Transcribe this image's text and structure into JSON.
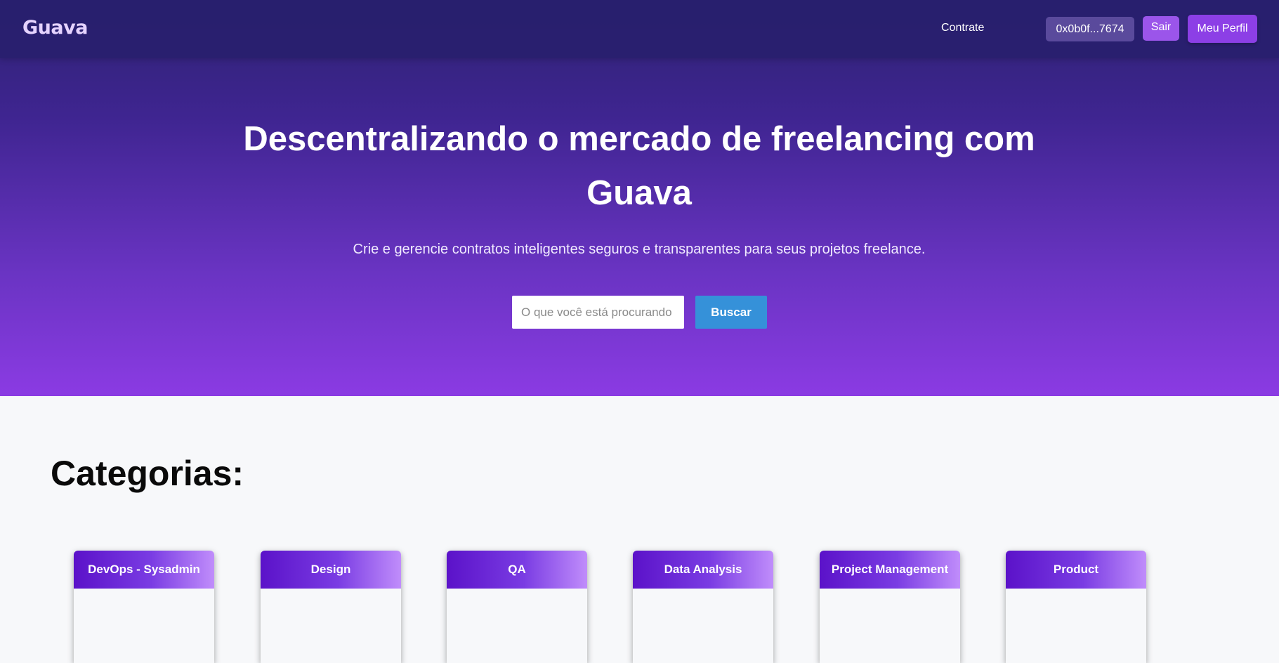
{
  "navbar": {
    "logo": "Guava",
    "link_contrate": "Contrate",
    "wallet_address": "0x0b0f...7674",
    "logout_label": "Sair",
    "profile_label": "Meu Perfil"
  },
  "hero": {
    "title": "Descentralizando o mercado de freelancing com Guava",
    "subtitle": "Crie e gerencie contratos inteligentes seguros e transparentes para seus projetos freelance.",
    "search": {
      "placeholder": "O que você está procurando",
      "value": "",
      "button_label": "Buscar"
    }
  },
  "categories": {
    "title": "Categorias:",
    "items": [
      {
        "label": "DevOps - Sysadmin"
      },
      {
        "label": "Design"
      },
      {
        "label": "QA"
      },
      {
        "label": "Data Analysis"
      },
      {
        "label": "Project Management"
      },
      {
        "label": "Product"
      }
    ]
  },
  "colors": {
    "accent_purple": "#8c3fe6",
    "button_blue": "#3591d9",
    "hero_top": "#2d2272",
    "hero_bottom": "#8b3be3"
  }
}
